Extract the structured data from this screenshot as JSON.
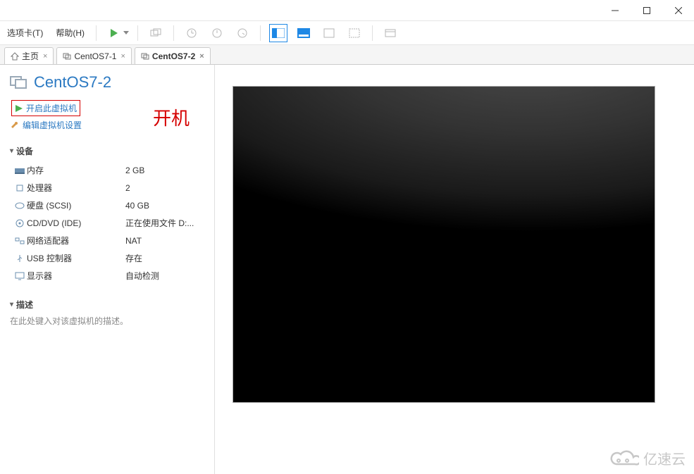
{
  "menu": {
    "options_tab": "选项卡(T)",
    "help": "帮助(H)"
  },
  "tabs": {
    "home": "主页",
    "t1": "CentOS7-1",
    "t2": "CentOS7-2"
  },
  "vm": {
    "title": "CentOS7-2",
    "power_on": "开启此虚拟机",
    "edit_settings": "编辑虚拟机设置"
  },
  "annotation": {
    "power_on_label": "开机"
  },
  "sections": {
    "devices": "设备",
    "description": "描述"
  },
  "devices": {
    "memory_label": "内存",
    "memory_value": "2 GB",
    "cpu_label": "处理器",
    "cpu_value": "2",
    "disk_label": "硬盘 (SCSI)",
    "disk_value": "40 GB",
    "cd_label": "CD/DVD (IDE)",
    "cd_value": "正在使用文件 D:...",
    "net_label": "网络适配器",
    "net_value": "NAT",
    "usb_label": "USB 控制器",
    "usb_value": "存在",
    "display_label": "显示器",
    "display_value": "自动检测"
  },
  "description_placeholder": "在此处键入对该虚拟机的描述。",
  "watermark": "亿速云"
}
